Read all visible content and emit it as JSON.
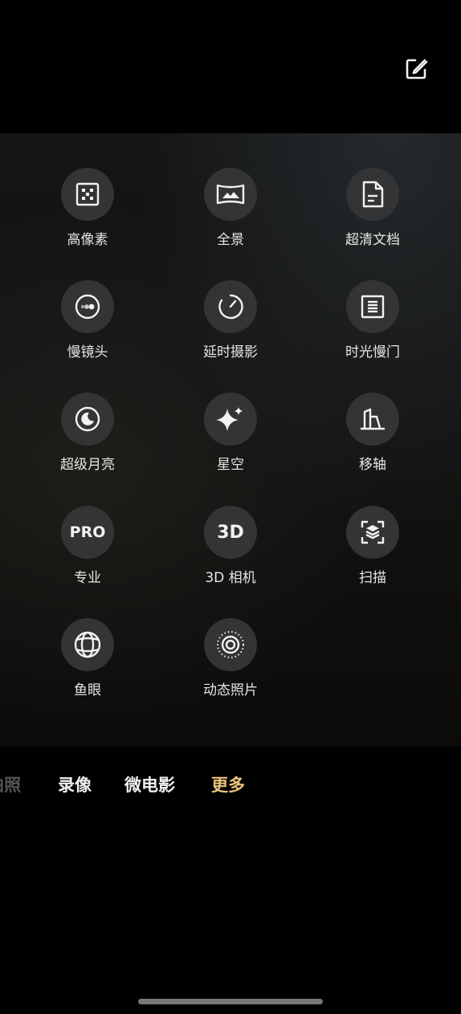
{
  "modes": [
    {
      "label": "高像素",
      "icon": "high-pixel-icon"
    },
    {
      "label": "全景",
      "icon": "panorama-icon"
    },
    {
      "label": "超清文档",
      "icon": "document-icon"
    },
    {
      "label": "慢镜头",
      "icon": "slow-motion-icon"
    },
    {
      "label": "延时摄影",
      "icon": "timelapse-icon"
    },
    {
      "label": "时光慢门",
      "icon": "long-exposure-icon"
    },
    {
      "label": "超级月亮",
      "icon": "moon-icon"
    },
    {
      "label": "星空",
      "icon": "sparkle-icon"
    },
    {
      "label": "移轴",
      "icon": "tilt-shift-icon"
    },
    {
      "label": "专业",
      "icon": "pro-icon",
      "icon_text": "PRO"
    },
    {
      "label": "3D 相机",
      "icon": "3d-icon",
      "icon_text": "3D"
    },
    {
      "label": "扫描",
      "icon": "scan-icon"
    },
    {
      "label": "鱼眼",
      "icon": "fisheye-icon"
    },
    {
      "label": "动态照片",
      "icon": "live-photo-icon"
    }
  ],
  "tabs": [
    {
      "label": "拍照",
      "visible_text": "拍照",
      "state": "faded"
    },
    {
      "label": "录像"
    },
    {
      "label": "微电影"
    },
    {
      "label": "更多",
      "state": "active"
    }
  ],
  "colors": {
    "active_tab": "#e9c27c",
    "icon_bg": "#333435"
  }
}
